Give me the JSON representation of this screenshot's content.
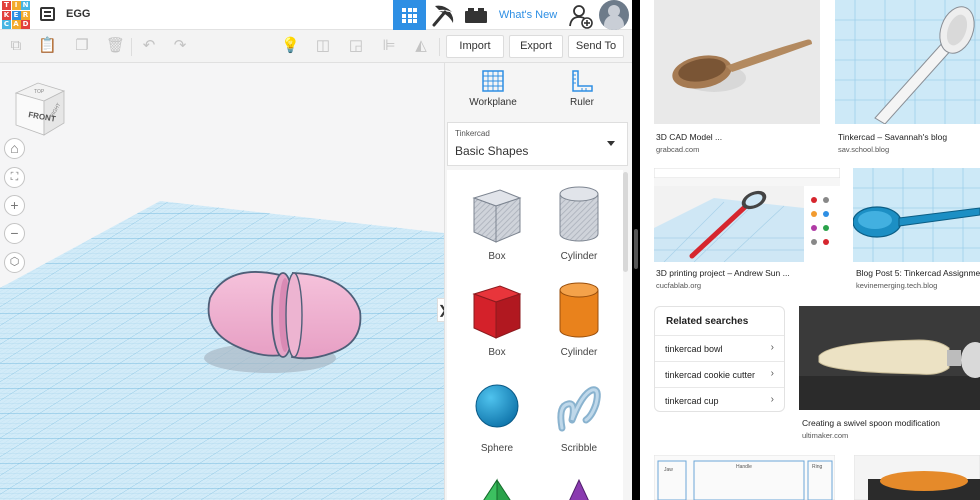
{
  "app": {
    "logo_letters": [
      "T",
      "I",
      "N",
      "K",
      "E",
      "R",
      "C",
      "A",
      "D"
    ],
    "logo_colors": [
      "#e2403c",
      "#f3aa2c",
      "#47b5e3",
      "#e2403c",
      "#2e8fe4",
      "#f3aa2c",
      "#47b5e3",
      "#f3aa2c",
      "#e2403c"
    ],
    "title": "EGG",
    "whats_new": "What's New",
    "accent": "#2e8fe4"
  },
  "toolbar": {
    "import_label": "Import",
    "export_label": "Export",
    "send_to_label": "Send To"
  },
  "viewcube": {
    "front": "FRONT",
    "top": "TOP",
    "right": "RIGHT"
  },
  "panel": {
    "workplane_label": "Workplane",
    "ruler_label": "Ruler",
    "category_small": "Tinkercad",
    "category": "Basic Shapes",
    "shapes": [
      {
        "label": "Box",
        "icon": "box-hole-icon"
      },
      {
        "label": "Cylinder",
        "icon": "cylinder-hole-icon"
      },
      {
        "label": "Box",
        "icon": "box-icon"
      },
      {
        "label": "Cylinder",
        "icon": "cylinder-icon"
      },
      {
        "label": "Sphere",
        "icon": "sphere-icon"
      },
      {
        "label": "Scribble",
        "icon": "scribble-icon"
      }
    ]
  },
  "results": {
    "items": [
      {
        "title": "3D CAD Model ...",
        "source": "grabcad.com"
      },
      {
        "title": "Tinkercad – Savannah's blog",
        "source": "sav.school.blog"
      },
      {
        "title": "3D printing project – Andrew Sun ...",
        "source": "cucfablab.org"
      },
      {
        "title": "Blog Post 5: Tinkercad Assignme",
        "source": "kevinemerging.tech.blog"
      },
      {
        "title": "Creating a swivel spoon modification",
        "source": "ultimaker.com"
      }
    ],
    "related_title": "Related searches",
    "related": [
      "tinkercad bowl",
      "tinkercad cookie cutter",
      "tinkercad cup"
    ],
    "bottom_labels": [
      "Jaw",
      "Handle",
      "Ring"
    ]
  }
}
